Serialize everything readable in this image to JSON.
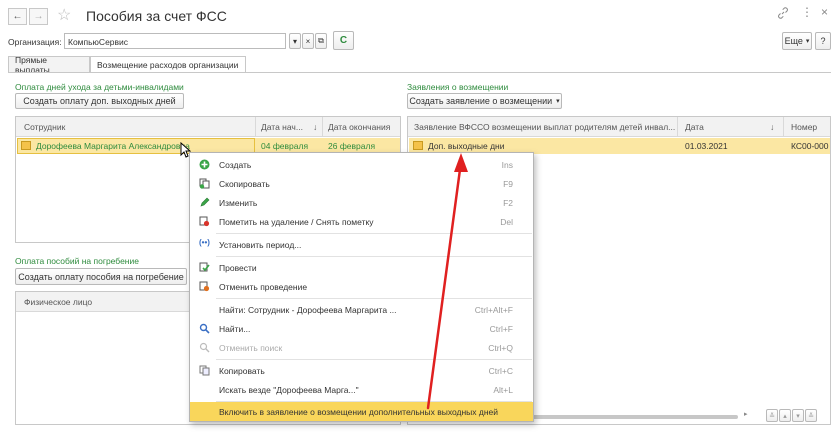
{
  "window": {
    "title": "Пособия за счет ФСС",
    "nav_back": "←",
    "nav_forward": "→",
    "star": "☆",
    "link_icon": "link-icon",
    "more_icon": "⋮",
    "close": "×"
  },
  "org": {
    "label": "Организация:",
    "value": "КомпьюСервис",
    "dropdown": "▾",
    "clear": "×",
    "open": "⧉",
    "refresh": "C"
  },
  "toolbar": {
    "more": "Еще",
    "more_arrow": "▾",
    "help": "?"
  },
  "tabs": [
    {
      "label": "Прямые выплаты"
    },
    {
      "label": "Возмещение расходов организации"
    }
  ],
  "left_top": {
    "section_label": "Оплата дней ухода за детьми-инвалидами",
    "create_button": "Создать оплату доп. выходных дней",
    "columns": [
      "Сотрудник",
      "Дата нач...",
      "↓",
      "Дата окончания"
    ],
    "rows": [
      {
        "employee": "Дорофеева Маргарита Александровна",
        "start": "04 февраля",
        "end": "26 февраля"
      }
    ]
  },
  "left_bottom": {
    "section_label": "Оплата пособий на погребение",
    "create_button": "Создать оплату пособия на погребение",
    "columns": [
      "Физическое лицо"
    ]
  },
  "right": {
    "section_label": "Заявления о возмещении",
    "create_button": "Создать заявление о возмещении",
    "create_arrow": "▾",
    "columns": [
      "Заявление ВФССО возмещении выплат родителям детей инвал...",
      "Дата",
      "↓",
      "Номер"
    ],
    "rows": [
      {
        "name": "Доп. выходные дни",
        "date": "01.03.2021",
        "number": "КС00-000"
      }
    ],
    "scroll_buttons": [
      "≚",
      "▴",
      "▾",
      "≚"
    ]
  },
  "context_menu": {
    "items": [
      {
        "label": "Создать",
        "shortcut": "Ins",
        "icon": "plus-icon"
      },
      {
        "label": "Скопировать",
        "shortcut": "F9",
        "icon": "copy-icon"
      },
      {
        "label": "Изменить",
        "shortcut": "F2",
        "icon": "pencil-icon"
      },
      {
        "label": "Пометить на удаление / Снять пометку",
        "shortcut": "Del",
        "icon": "delete-mark-icon"
      },
      {
        "label": "Установить период...",
        "shortcut": "",
        "icon": "period-icon"
      },
      {
        "label": "Провести",
        "shortcut": "",
        "icon": "post-icon"
      },
      {
        "label": "Отменить проведение",
        "shortcut": "",
        "icon": "unpost-icon"
      },
      {
        "label": "Найти: Сотрудник - Дорофеева Маргарита ...",
        "shortcut": "Ctrl+Alt+F",
        "icon": ""
      },
      {
        "label": "Найти...",
        "shortcut": "Ctrl+F",
        "icon": "search-icon"
      },
      {
        "label": "Отменить поиск",
        "shortcut": "Ctrl+Q",
        "icon": "cancel-search-icon"
      },
      {
        "label": "Копировать",
        "shortcut": "Ctrl+C",
        "icon": "clipboard-icon"
      },
      {
        "label": "Искать везде \"Дорофеева Марга...\"",
        "shortcut": "Alt+L",
        "icon": ""
      },
      {
        "label": "Включить в заявление о возмещении дополнительных выходных дней",
        "shortcut": "",
        "icon": ""
      }
    ]
  },
  "colors": {
    "accent_green": "#2e8b3d",
    "selection": "#fbe7a3",
    "highlight": "#f9d65b",
    "arrow_red": "#e02020"
  }
}
